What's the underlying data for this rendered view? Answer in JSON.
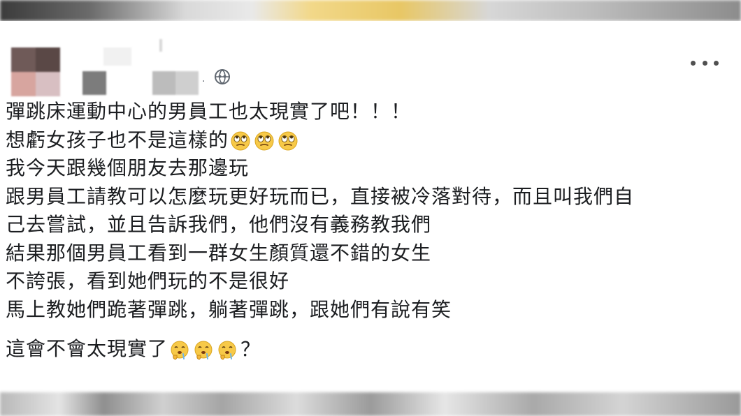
{
  "post": {
    "meta_separator": "·",
    "privacy_icon": "globe-icon",
    "menu_icon": "more-options-icon",
    "lines": [
      "彈跳床運動中心的男員工也太現實了吧！！！",
      "想虧女孩子也不是這樣的",
      "我今天跟幾個朋友去那邊玩",
      "跟男員工請教可以怎麼玩更好玩而已，直接被冷落對待，而且叫我們自",
      "己去嘗試，並且告訴我們，他們沒有義務教我們",
      "結果那個男員工看到一群女生顏質還不錯的女生",
      "不誇張，看到她們玩的不是很好",
      "馬上教她們跪著彈跳，躺著彈跳，跟她們有說有笑",
      "這會不會太現實了"
    ],
    "line2_emojis": [
      "eye-roll-emoji",
      "eye-roll-emoji",
      "eye-roll-emoji"
    ],
    "last_line_emojis": [
      "drooling-thinking-emoji",
      "drooling-thinking-emoji",
      "drooling-thinking-emoji"
    ],
    "last_line_suffix": "？"
  },
  "colors": {
    "text": "#1c1e21",
    "meta": "#606770",
    "emoji_yellow": "#f7c948"
  }
}
